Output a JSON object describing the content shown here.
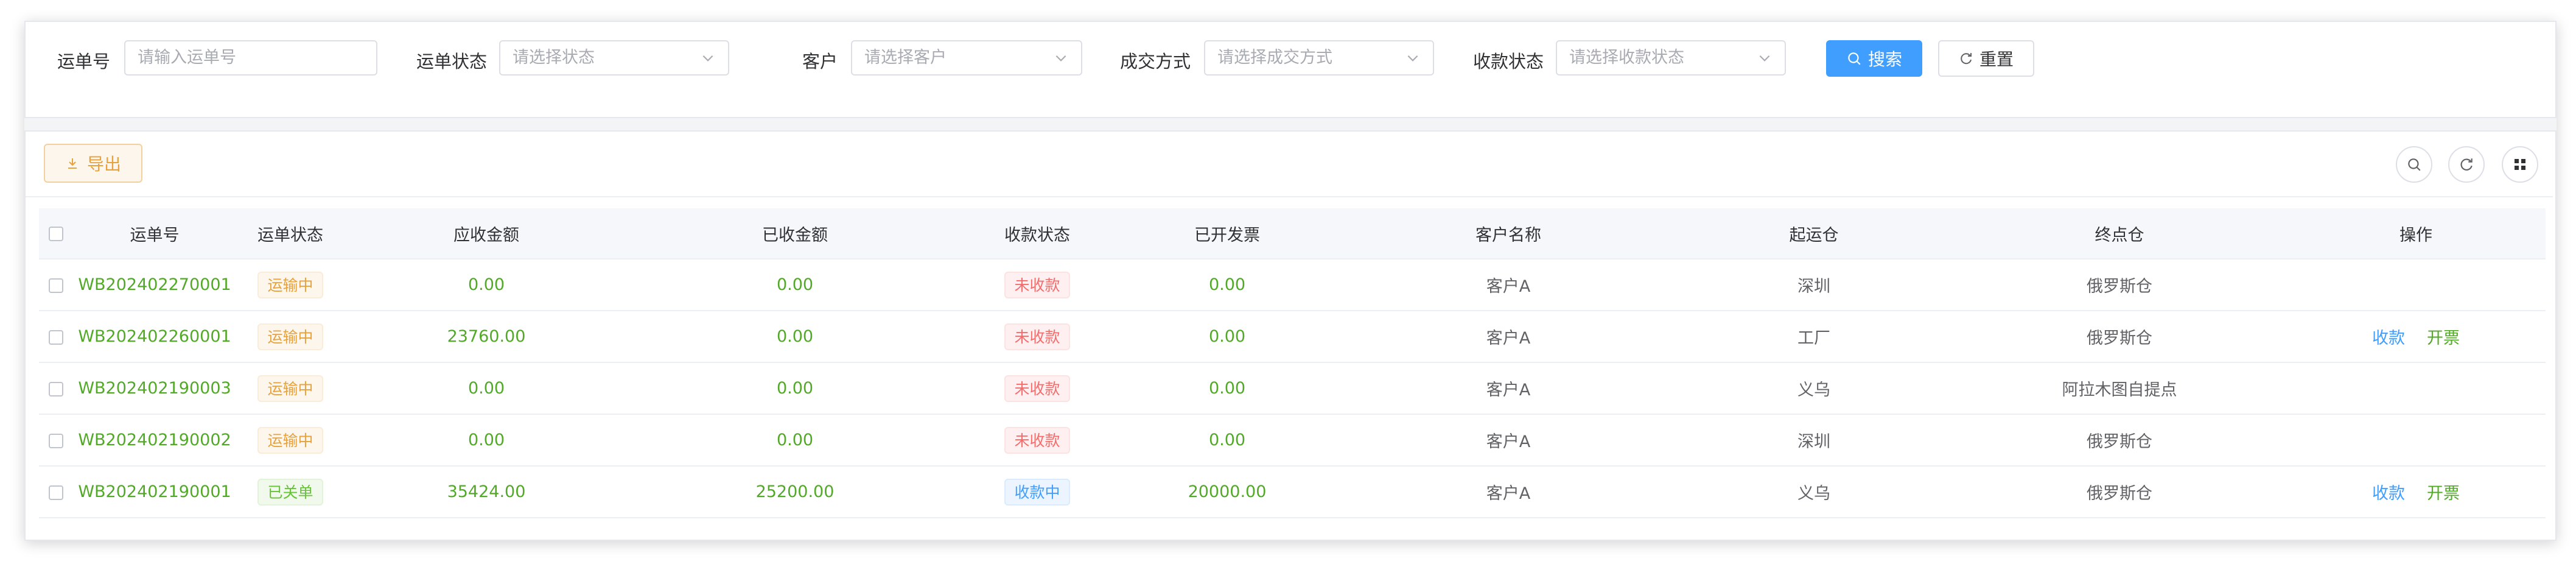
{
  "filters": {
    "order_no": {
      "label": "运单号",
      "placeholder": "请输入运单号"
    },
    "order_status": {
      "label": "运单状态",
      "placeholder": "请选择状态"
    },
    "customer": {
      "label": "客户",
      "placeholder": "请选择客户"
    },
    "deal_method": {
      "label": "成交方式",
      "placeholder": "请选择成交方式"
    },
    "payment_status": {
      "label": "收款状态",
      "placeholder": "请选择收款状态"
    },
    "search_label": "搜索",
    "reset_label": "重置"
  },
  "toolbar": {
    "export_label": "导出",
    "icons": [
      "search-icon",
      "refresh-icon",
      "columns-icon"
    ]
  },
  "table": {
    "headers": [
      "运单号",
      "运单状态",
      "应收金额",
      "已收金额",
      "收款状态",
      "已开发票",
      "客户名称",
      "起运仓",
      "终点仓",
      "操作"
    ],
    "rows": [
      {
        "order_no": "WB202402270001",
        "status": "运输中",
        "receivable": "0.00",
        "received": "0.00",
        "pay_status": "未收款",
        "invoiced": "0.00",
        "customer": "客户A",
        "origin": "深圳",
        "dest": "俄罗斯仓",
        "actions": []
      },
      {
        "order_no": "WB202402260001",
        "status": "运输中",
        "receivable": "23760.00",
        "received": "0.00",
        "pay_status": "未收款",
        "invoiced": "0.00",
        "customer": "客户A",
        "origin": "工厂",
        "dest": "俄罗斯仓",
        "actions": [
          "收款",
          "开票"
        ]
      },
      {
        "order_no": "WB202402190003",
        "status": "运输中",
        "receivable": "0.00",
        "received": "0.00",
        "pay_status": "未收款",
        "invoiced": "0.00",
        "customer": "客户A",
        "origin": "义乌",
        "dest": "阿拉木图自提点",
        "actions": []
      },
      {
        "order_no": "WB202402190002",
        "status": "运输中",
        "receivable": "0.00",
        "received": "0.00",
        "pay_status": "未收款",
        "invoiced": "0.00",
        "customer": "客户A",
        "origin": "深圳",
        "dest": "俄罗斯仓",
        "actions": []
      },
      {
        "order_no": "WB202402190001",
        "status": "已关单",
        "receivable": "35424.00",
        "received": "25200.00",
        "pay_status": "收款中",
        "invoiced": "20000.00",
        "customer": "客户A",
        "origin": "义乌",
        "dest": "俄罗斯仓",
        "actions": [
          "收款",
          "开票"
        ]
      }
    ]
  },
  "colors": {
    "primary": "#409eff",
    "success": "#52a928",
    "warning": "#e6a23c",
    "danger": "#f56c6c"
  }
}
